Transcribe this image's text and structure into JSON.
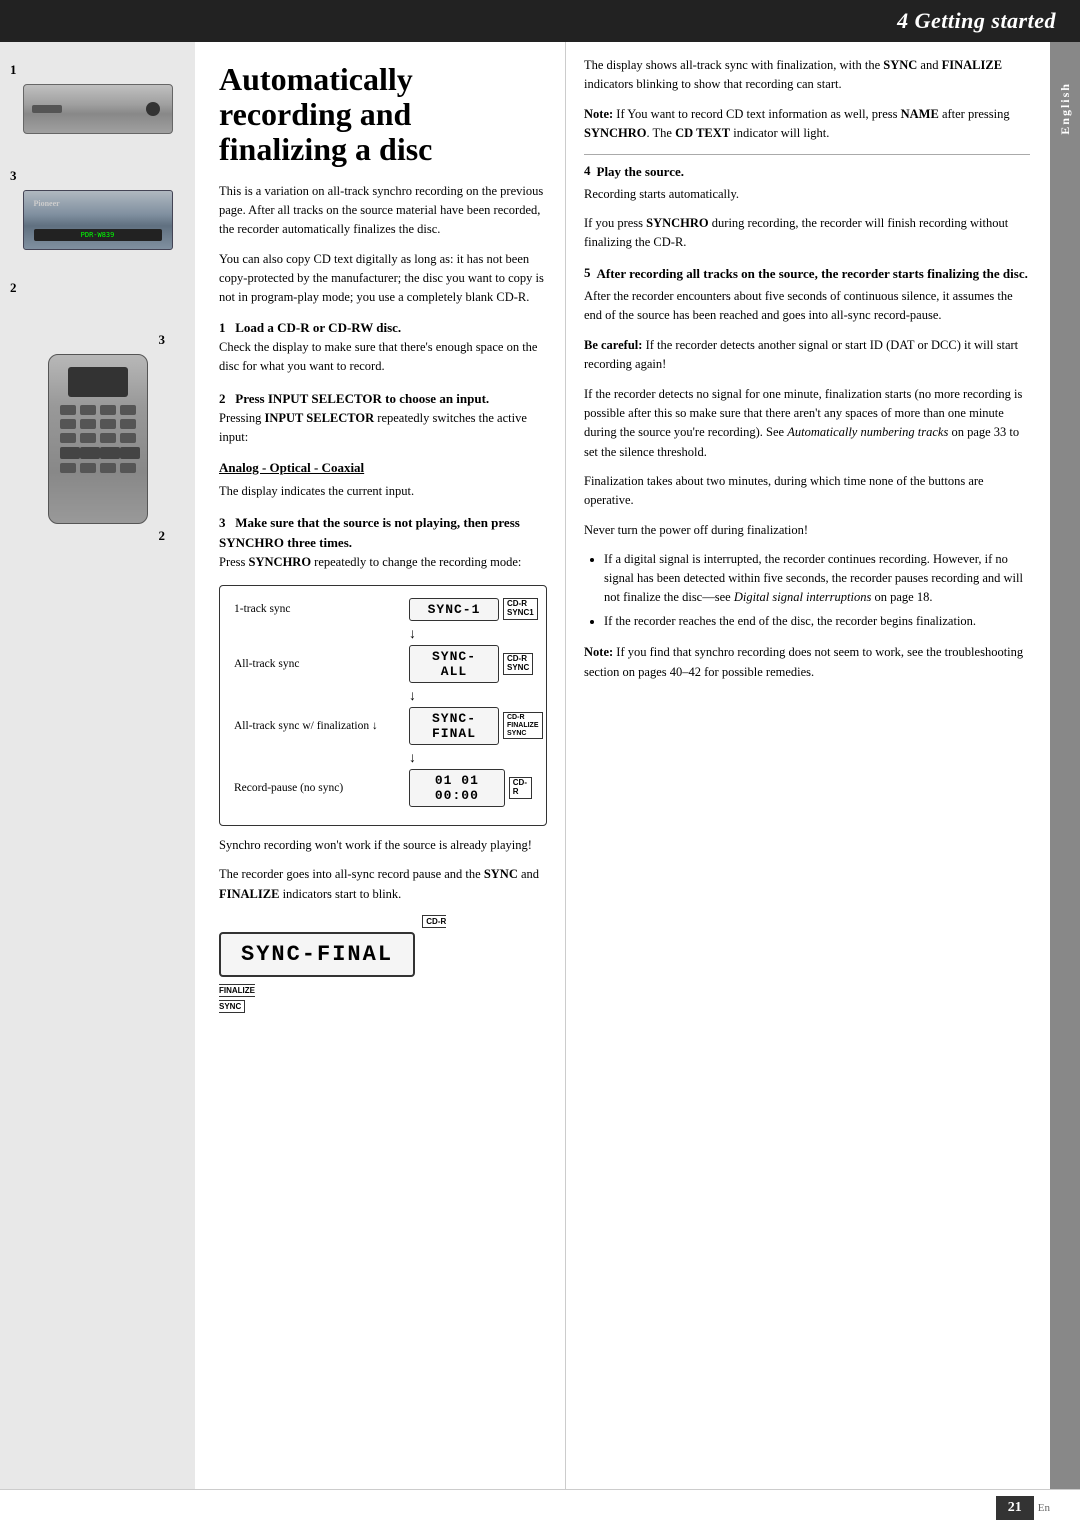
{
  "header": {
    "title": "4 Getting started"
  },
  "left_sidebar": {
    "label1": "1",
    "label2": "3",
    "label3": "2",
    "label4": "3",
    "label5": "2"
  },
  "right_sidebar": {
    "label": "English"
  },
  "page_title": "Automatically recording and finalizing a disc",
  "intro_paragraphs": [
    "This is a variation on all-track synchro recording on the previous page. After all tracks on the source material have been recorded, the recorder automatically finalizes the disc.",
    "You can also copy CD text digitally as long as: it has not been copy-protected by the manufacturer; the disc you want to copy is not in program-play mode; you use a completely blank CD-R."
  ],
  "steps_left": [
    {
      "number": "1",
      "heading": "Load a CD-R or CD-RW disc.",
      "body": "Check the display to make sure that there's enough space on the disc for what you want to record."
    },
    {
      "number": "2",
      "heading": "Press INPUT SELECTOR to choose an input.",
      "sub": "Pressing INPUT SELECTOR repeatedly switches the active input:",
      "analog_label": "Analog - Optical -  Coaxial",
      "display_note": "The display indicates the current input."
    },
    {
      "number": "3",
      "heading": "Make sure that the source is not playing, then press SYNCHRO three times.",
      "sub": "Press SYNCHRO repeatedly to change the recording mode:"
    }
  ],
  "sync_diagram": {
    "rows": [
      {
        "label": "1-track sync",
        "box": "SYNC-1",
        "badge1": "CD-R",
        "badge2": "SYNC1",
        "arrow": false
      },
      {
        "label": "All-track sync",
        "box": "SYNC-ALL",
        "badge1": "CD-R",
        "badge2": "SYNC",
        "arrow": true
      },
      {
        "label": "All-track sync w/ finalization",
        "box": "SYNC-FINAL",
        "badge1": "CD-R",
        "badge2": "FINALIZE\nSYNC",
        "arrow": true
      },
      {
        "label": "Record-pause (no sync)",
        "box": "01 01 00:00",
        "badge1": "CD-R",
        "badge2": "",
        "arrow": true
      }
    ]
  },
  "sync_note1": "Synchro recording won't work if the source is already playing!",
  "sync_note2_prefix": "The recorder goes into all-sync record pause and the ",
  "sync_note2_bold1": "SYNC",
  "sync_note2_mid": " and ",
  "sync_note2_bold2": "FINALIZE",
  "sync_note2_suffix": " indicators start to blink.",
  "sync_final_large": "SYNC-FINAL",
  "right_intro": "The display shows all-track sync with finalization, with the ",
  "right_intro_bold1": "SYNC",
  "right_intro_mid": " and ",
  "right_intro_bold2": "FINALIZE",
  "right_intro_suffix": " indicators blinking to show that recording can start.",
  "note_block": {
    "label": "Note:",
    "text": " If You want to record CD text information as well, press ",
    "bold1": "NAME",
    "mid": " after pressing ",
    "bold2": "SYNCHRO",
    "mid2": ". The ",
    "bold3": "CD TEXT",
    "suffix": " indicator will light."
  },
  "steps_right": [
    {
      "number": "4",
      "heading": "Play the source.",
      "body": "Recording starts automatically.",
      "body2_prefix": "If you press ",
      "body2_bold": "SYNCHRO",
      "body2_suffix": " during recording, the recorder will finish recording without finalizing the CD-R."
    },
    {
      "number": "5",
      "heading": "After recording all tracks on the source, the recorder starts finalizing the disc.",
      "body1": "After the recorder encounters about five seconds of continuous silence, it assumes the end of the source has been reached and goes into all-sync record-pause.",
      "becareful_label": "Be careful:",
      "becareful_text": " If the recorder detects another signal or start ID (DAT or DCC) it will start recording again!",
      "body2": "If the recorder detects no signal for one minute, finalization starts (no more recording is possible after this so make sure that there aren't any spaces of more than one minute during the source you're recording). See ",
      "body2_italic": "Automatically numbering tracks",
      "body2_mid": " on page 33 to set the silence threshold.",
      "body3": "Finalization takes about two minutes, during which time none of the buttons are operative.",
      "body4": "Never turn the power off during finalization!",
      "bullets": [
        {
          "prefix": "If a digital signal is interrupted, the recorder continues recording. However, if no signal has been detected within five seconds, the recorder pauses recording and will not finalize the disc—see ",
          "italic": "Digital signal interruptions",
          "suffix": " on page 18."
        },
        {
          "prefix": "If the recorder reaches the end of the disc, the recorder begins finalization."
        }
      ]
    }
  ],
  "final_note": {
    "label": "Note:",
    "text": " If you find that synchro recording does not seem to work, see the troubleshooting section on pages 40–42 for possible remedies."
  },
  "footer": {
    "page_number": "21",
    "en_label": "En"
  }
}
